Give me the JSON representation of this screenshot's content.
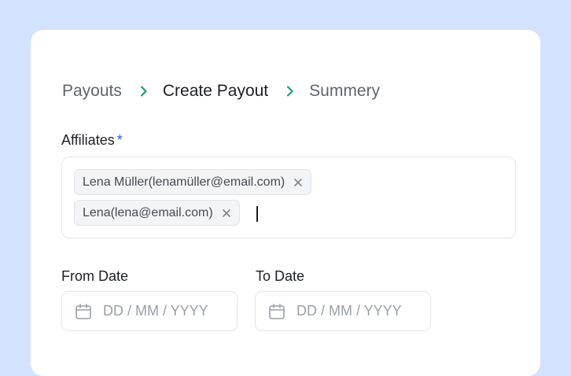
{
  "breadcrumb": {
    "items": [
      {
        "label": "Payouts"
      },
      {
        "label": "Create Payout"
      },
      {
        "label": "Summery"
      }
    ]
  },
  "affiliates": {
    "label": "Affiliates",
    "required_mark": "*",
    "chips": [
      {
        "label": "Lena Müller(lenamüller@email.com)"
      },
      {
        "label": "Lena(lena@email.com)"
      }
    ]
  },
  "from_date": {
    "label": "From Date",
    "placeholder": "DD / MM / YYYY"
  },
  "to_date": {
    "label": "To Date",
    "placeholder": "DD / MM / YYYY"
  },
  "colors": {
    "background": "#d3e2fe",
    "chevron": "#1a9e72",
    "required": "#2c5bd8"
  }
}
